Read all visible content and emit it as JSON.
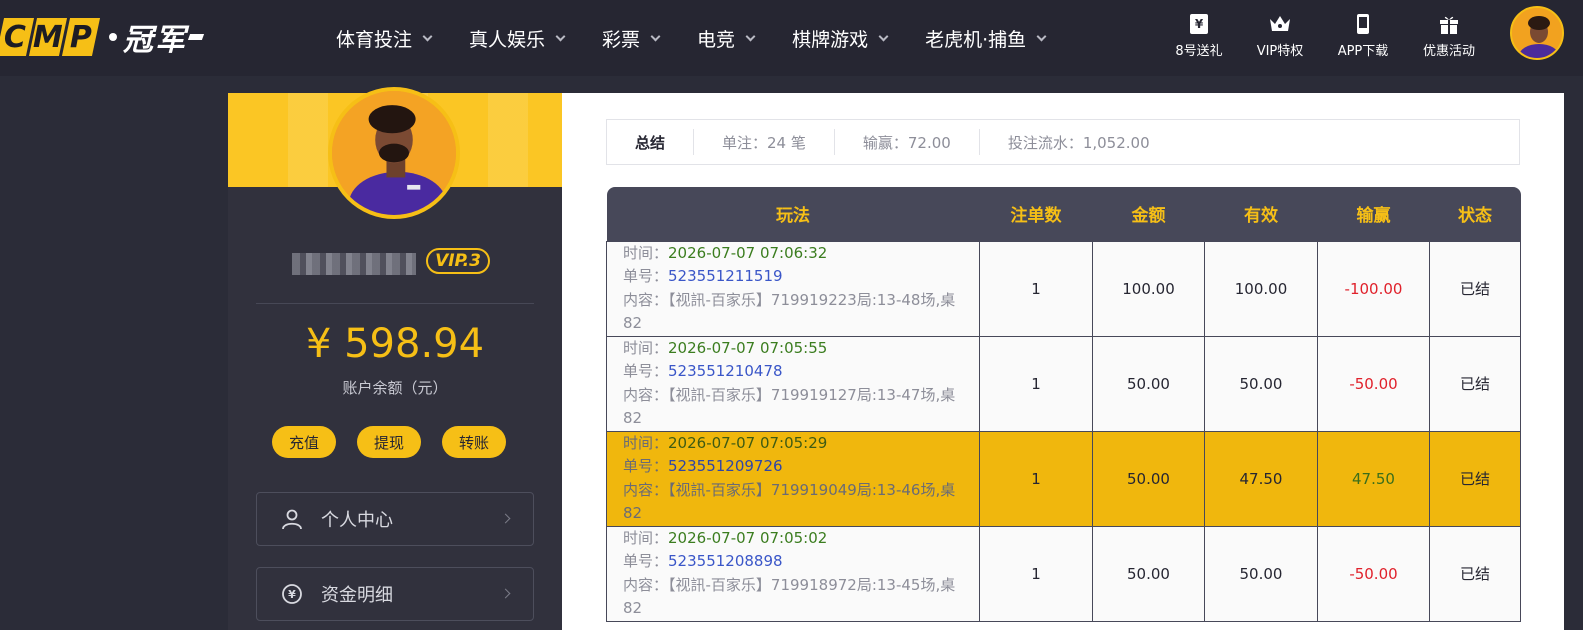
{
  "brand": {
    "letters": [
      "C",
      "M",
      "P"
    ],
    "name": "冠军"
  },
  "nav": [
    {
      "label": "体育投注"
    },
    {
      "label": "真人娱乐"
    },
    {
      "label": "彩票"
    },
    {
      "label": "电竞"
    },
    {
      "label": "棋牌游戏"
    },
    {
      "label": "老虎机·捕鱼"
    }
  ],
  "quick_links": [
    {
      "label": "8号送礼",
      "icon": "gift-ticket-icon"
    },
    {
      "label": "VIP特权",
      "icon": "crown-icon"
    },
    {
      "label": "APP下载",
      "icon": "phone-icon"
    },
    {
      "label": "优惠活动",
      "icon": "gift-box-icon"
    }
  ],
  "sidebar": {
    "vip_label": "VIP.3",
    "balance": "¥ 598.94",
    "balance_label": "账户余额（元）",
    "actions": [
      "充值",
      "提现",
      "转账"
    ],
    "menu": [
      {
        "label": "个人中心",
        "icon": "user-icon"
      },
      {
        "label": "资金明细",
        "icon": "money-icon"
      }
    ]
  },
  "summary": {
    "title": "总结",
    "bets": "单注：24 笔",
    "win_loss": "输赢：72.00",
    "turnover": "投注流水：1,052.00"
  },
  "table": {
    "headers": [
      "玩法",
      "注单数",
      "金额",
      "有效",
      "输赢",
      "状态"
    ],
    "labels": {
      "time": "时间：",
      "id": "单号：",
      "content": "内容："
    },
    "rows": [
      {
        "time": "2026-07-07 07:06:32",
        "id": "523551211519",
        "content": "【视訊-百家乐】719919223局:13-48场,桌82",
        "count": "1",
        "amount": "100.00",
        "valid": "100.00",
        "result": "-100.00",
        "status": "已结",
        "highlight": false
      },
      {
        "time": "2026-07-07 07:05:55",
        "id": "523551210478",
        "content": "【视訊-百家乐】719919127局:13-47场,桌82",
        "count": "1",
        "amount": "50.00",
        "valid": "50.00",
        "result": "-50.00",
        "status": "已结",
        "highlight": false
      },
      {
        "time": "2026-07-07 07:05:29",
        "id": "523551209726",
        "content": "【视訊-百家乐】719919049局:13-46场,桌82",
        "count": "1",
        "amount": "50.00",
        "valid": "47.50",
        "result": "47.50",
        "status": "已结",
        "highlight": true
      },
      {
        "time": "2026-07-07 07:05:02",
        "id": "523551208898",
        "content": "【视訊-百家乐】719918972局:13-45场,桌82",
        "count": "1",
        "amount": "50.00",
        "valid": "50.00",
        "result": "-50.00",
        "status": "已结",
        "highlight": false
      }
    ]
  },
  "colors": {
    "accent": "#f6bf16",
    "header_bg": "#262632",
    "negative": "#e0212b",
    "positive": "#3b6e1a"
  }
}
